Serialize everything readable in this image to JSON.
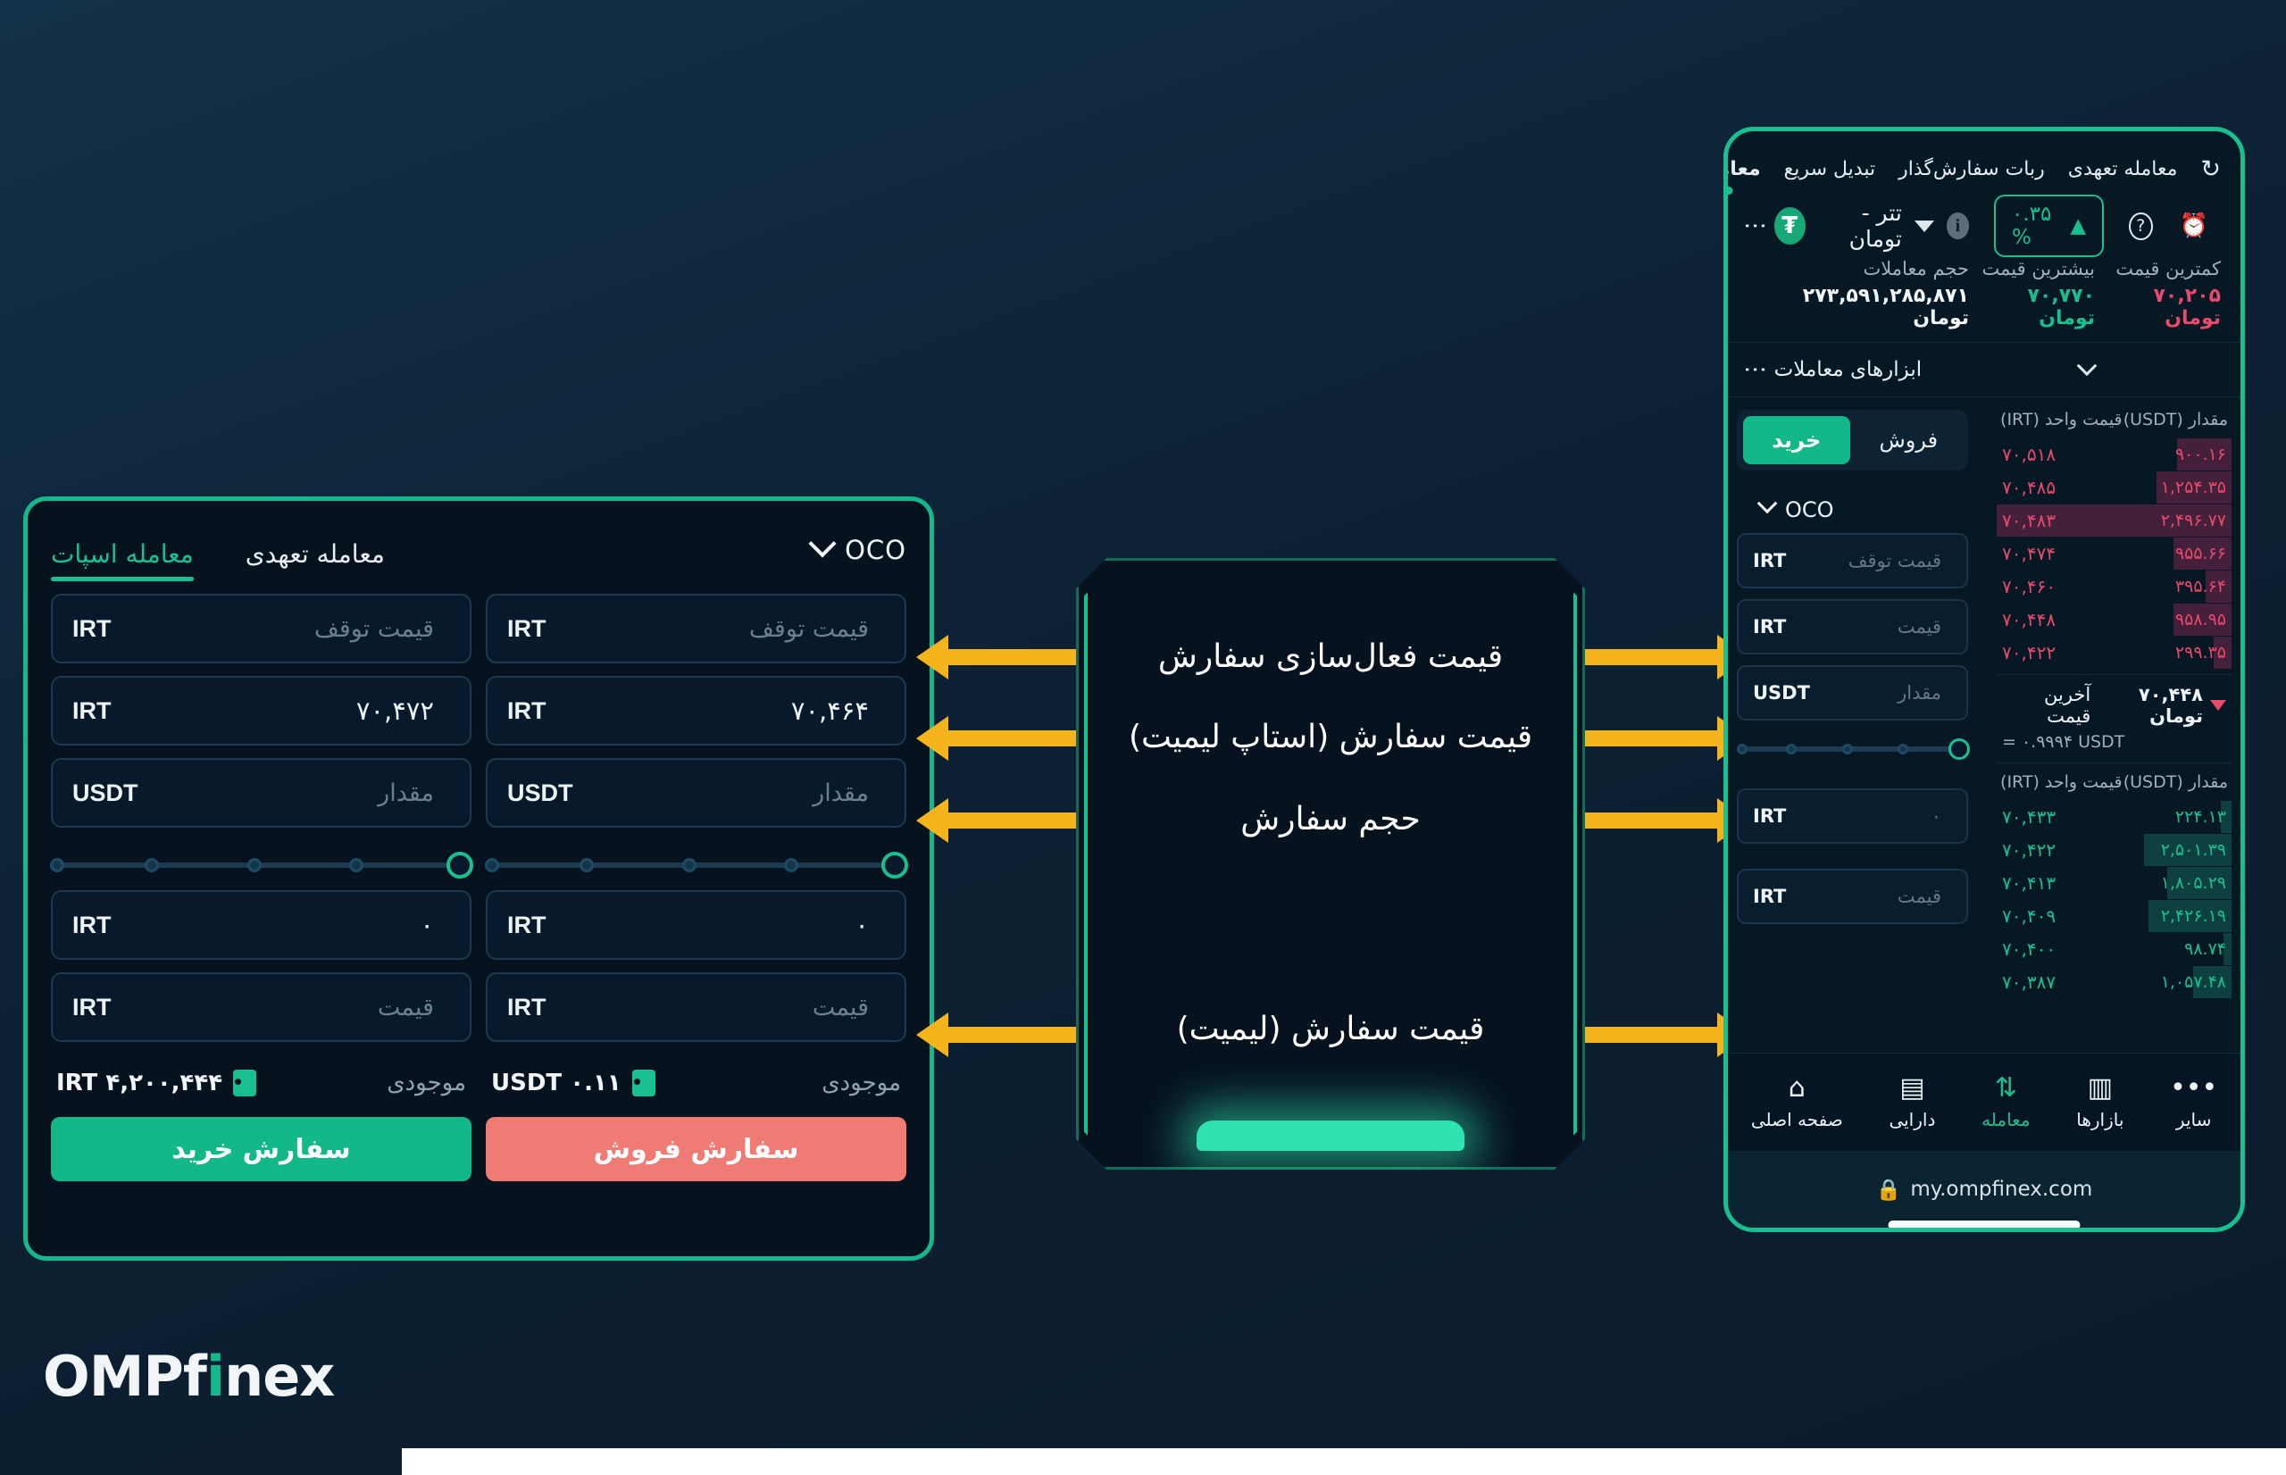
{
  "brand": {
    "name_part1": "OMPf",
    "name_accent": "i",
    "name_part2": "nex"
  },
  "left_panel": {
    "order_type": "OCO",
    "tabs": [
      {
        "label": "معامله اسپات",
        "active": true
      },
      {
        "label": "معامله تعهدی",
        "active": false
      }
    ],
    "buy_column": {
      "stop_price": {
        "placeholder": "قیمت توقف",
        "value": "",
        "unit": "IRT"
      },
      "limit_price": {
        "placeholder": "",
        "value": "۷۰,۴۷۲",
        "unit": "IRT"
      },
      "amount": {
        "placeholder": "مقدار",
        "value": "",
        "unit": "USDT"
      },
      "total": {
        "placeholder": "",
        "value": "۰",
        "unit": "IRT"
      },
      "price": {
        "placeholder": "قیمت",
        "value": "",
        "unit": "IRT"
      },
      "balance_label": "موجودی",
      "balance_value": "۴,۲۰۰,۴۴۴ IRT",
      "submit_label": "سفارش خرید"
    },
    "sell_column": {
      "stop_price": {
        "placeholder": "قیمت توقف",
        "value": "",
        "unit": "IRT"
      },
      "limit_price": {
        "placeholder": "",
        "value": "۷۰,۴۶۴",
        "unit": "IRT"
      },
      "amount": {
        "placeholder": "مقدار",
        "value": "",
        "unit": "USDT"
      },
      "total": {
        "placeholder": "",
        "value": "۰",
        "unit": "IRT"
      },
      "price": {
        "placeholder": "قیمت",
        "value": "",
        "unit": "IRT"
      },
      "balance_label": "موجودی",
      "balance_value": "۰.۱۱ USDT",
      "submit_label": "سفارش فروش"
    }
  },
  "annotations": [
    {
      "label": "قیمت فعال‌سازی سفارش"
    },
    {
      "label": "قیمت سفارش (استاپ لیمیت)"
    },
    {
      "label": "حجم سفارش"
    },
    {
      "label": "قیمت سفارش (لیمیت)"
    }
  ],
  "phone": {
    "top_tabs": [
      {
        "label": "معامله",
        "active": true
      },
      {
        "label": "تبدیل سریع",
        "active": false
      },
      {
        "label": "ربات سفارش‌گذار",
        "active": false
      },
      {
        "label": "معامله تعهدی",
        "active": false
      }
    ],
    "refresh_icon": "↻",
    "market": {
      "coin_symbol": "₮",
      "name": "تتر - تومان",
      "change": "۰.۳۵ %",
      "change_dir": "▲"
    },
    "stats": [
      {
        "label": "حجم معاملات",
        "value": "۲۷۳,۵۹۱,۲۸۵,۸۷۱ تومان",
        "tone": "white"
      },
      {
        "label": "بیشترین قیمت",
        "value": "۷۰,۷۷۰ تومان",
        "tone": "green"
      },
      {
        "label": "کمترین قیمت",
        "value": "۷۰,۲۰۵ تومان",
        "tone": "red"
      }
    ],
    "tools_label": "ابزارهای معاملات",
    "side_toggle": [
      {
        "label": "خرید",
        "active": true
      },
      {
        "label": "فروش",
        "active": false
      }
    ],
    "order_type": "OCO",
    "fields": [
      {
        "placeholder": "قیمت توقف",
        "unit": "IRT"
      },
      {
        "placeholder": "قیمت",
        "unit": "IRT"
      },
      {
        "placeholder": "مقدار",
        "unit": "USDT"
      }
    ],
    "fields_lower": [
      {
        "placeholder": "۰",
        "unit": "IRT"
      },
      {
        "placeholder": "قیمت",
        "unit": "IRT"
      }
    ],
    "orderbook": {
      "header_price": "قیمت واحد (IRT)",
      "header_amount": "مقدار (USDT)",
      "asks": [
        {
          "price": "۷۰,۵۱۸",
          "amount": "۹۰۰.۱۶",
          "depth": 42
        },
        {
          "price": "۷۰,۴۸۵",
          "amount": "۱,۲۵۴.۳۵",
          "depth": 58
        },
        {
          "price": "۷۰,۴۸۳",
          "amount": "۲,۴۹۶.۷۷",
          "depth": 100
        },
        {
          "price": "۷۰,۴۷۴",
          "amount": "۹۵۵.۶۶",
          "depth": 45
        },
        {
          "price": "۷۰,۴۶۰",
          "amount": "۳۹۵.۶۴",
          "depth": 20
        },
        {
          "price": "۷۰,۴۴۸",
          "amount": "۹۵۸.۹۵",
          "depth": 45
        },
        {
          "price": "۷۰,۴۲۲",
          "amount": "۲۹۹.۳۵",
          "depth": 14
        }
      ],
      "last_price_label": "آخرین قیمت",
      "last_price": "۷۰,۴۴۸ تومان",
      "last_price_sub": "= ۰.۹۹۹۴ USDT",
      "bids": [
        {
          "price": "۷۰,۴۳۳",
          "amount": "۲۲۴.۱۳",
          "depth": 8
        },
        {
          "price": "۷۰,۴۲۲",
          "amount": "۲,۵۰۱.۳۹",
          "depth": 68
        },
        {
          "price": "۷۰,۴۱۳",
          "amount": "۱,۸۰۵.۲۹",
          "depth": 50
        },
        {
          "price": "۷۰,۴۰۹",
          "amount": "۲,۴۲۶.۱۹",
          "depth": 64
        },
        {
          "price": "۷۰,۴۰۰",
          "amount": "۹۸.۷۴",
          "depth": 6
        },
        {
          "price": "۷۰,۳۸۷",
          "amount": "۱,۰۵۷.۴۸",
          "depth": 30
        }
      ]
    },
    "bottom_nav": [
      {
        "label": "صفحه اصلی",
        "icon": "⌂",
        "active": false
      },
      {
        "label": "دارایی",
        "icon": "▤",
        "active": false
      },
      {
        "label": "معامله",
        "icon": "⇅",
        "active": true
      },
      {
        "label": "بازارها",
        "icon": "▥",
        "active": false
      },
      {
        "label": "سایر",
        "icon": "•••",
        "active": false
      }
    ],
    "url": "my.ompfinex.com",
    "lock_icon": "🔒"
  },
  "colors": {
    "accent_teal": "#19c08f",
    "sell_red": "#ef7b74",
    "arrow_yellow": "#f5b31c",
    "bg_dark": "#0d2134"
  }
}
